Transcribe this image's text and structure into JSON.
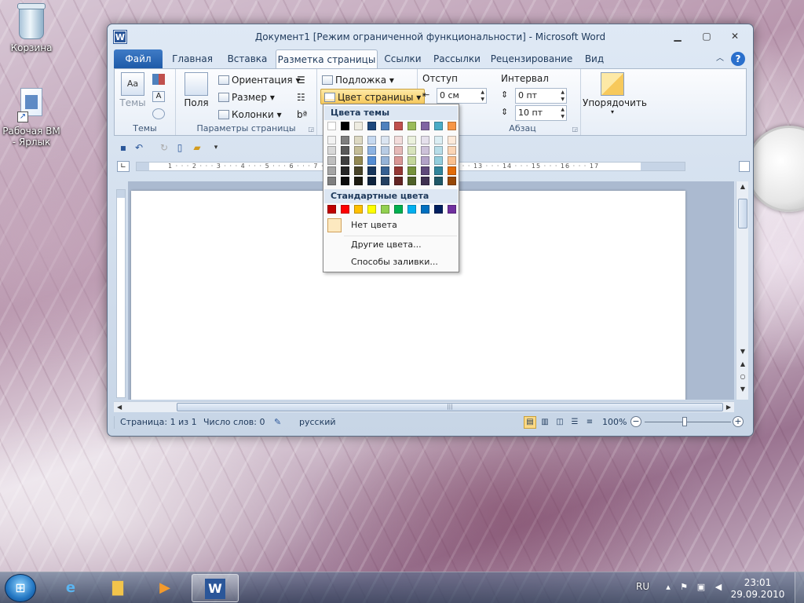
{
  "desktop": {
    "icons": [
      {
        "label": "Корзина"
      },
      {
        "label": "Рабочая ВМ - Ярлык"
      }
    ]
  },
  "window": {
    "title": "Документ1 [Режим ограниченной функциональности]  -  Microsoft Word",
    "app_icon": "W",
    "controls": {
      "minimize": "▁",
      "maximize": "▢",
      "close": "✕"
    }
  },
  "tabs": [
    "Файл",
    "Главная",
    "Вставка",
    "Разметка страницы",
    "Ссылки",
    "Рассылки",
    "Рецензирование",
    "Вид"
  ],
  "ribbon": {
    "themes_group": {
      "label": "Темы",
      "button": "Темы"
    },
    "page_setup": {
      "label": "Параметры страницы",
      "margins": "Поля",
      "orientation": "Ориентация",
      "size": "Размер",
      "columns": "Колонки"
    },
    "page_background": {
      "watermark": "Подложка",
      "page_color": "Цвет страницы"
    },
    "paragraph": {
      "label": "Абзац",
      "indent_label": "Отступ",
      "indent_left": "0 см",
      "spacing_label": "Интервал",
      "spacing_before": "0 пт",
      "spacing_after": "10 пт"
    },
    "arrange": {
      "label": "Упорядочить"
    }
  },
  "dropdown": {
    "theme_colors_title": "Цвета темы",
    "theme_top_row": [
      "#ffffff",
      "#000000",
      "#eeece1",
      "#1f497d",
      "#4f81bd",
      "#c0504d",
      "#9bbb59",
      "#8064a2",
      "#4bacc6",
      "#f79646"
    ],
    "theme_shades": [
      [
        "#f2f2f2",
        "#7f7f7f",
        "#ddd9c3",
        "#c6d9f0",
        "#dbe5f1",
        "#f2dcdb",
        "#ebf1dd",
        "#e5e0ec",
        "#dbeef3",
        "#fdeada"
      ],
      [
        "#d8d8d8",
        "#595959",
        "#c4bd97",
        "#8db3e2",
        "#b8cce4",
        "#e5b9b7",
        "#d7e3bc",
        "#ccc1d9",
        "#b7dde8",
        "#fbd5b5"
      ],
      [
        "#bfbfbf",
        "#3f3f3f",
        "#938953",
        "#548dd4",
        "#95b3d7",
        "#d99694",
        "#c3d69b",
        "#b2a2c7",
        "#92cddc",
        "#fac08f"
      ],
      [
        "#a5a5a5",
        "#262626",
        "#494429",
        "#17365d",
        "#366092",
        "#953734",
        "#76923c",
        "#5f497a",
        "#31859b",
        "#e36c09"
      ],
      [
        "#7f7f7f",
        "#0c0c0c",
        "#1d1b10",
        "#0f243e",
        "#244061",
        "#632423",
        "#4f6128",
        "#3f3151",
        "#205867",
        "#974806"
      ]
    ],
    "standard_colors_title": "Стандартные цвета",
    "standard_colors": [
      "#c00000",
      "#ff0000",
      "#ffc000",
      "#ffff00",
      "#92d050",
      "#00b050",
      "#00b0f0",
      "#0070c0",
      "#002060",
      "#7030a0"
    ],
    "no_color": "Нет цвета",
    "more_colors": "Другие цвета...",
    "fill_effects": "Способы заливки..."
  },
  "ruler": {
    "marks": "1 · · · 2 · · · 3 · · · 4 · · · 5 · · · 6 · · · 7 · · · 8 · · · 9 · · · 10 · · · 11 · · · 12 · · · 13 · · · 14 · · · 15 · · · 16 · · · 17"
  },
  "status": {
    "page": "Страница: 1 из 1",
    "words": "Число слов: 0",
    "language": "русский",
    "zoom": "100%"
  },
  "taskbar": {
    "language": "RU",
    "time": "23:01",
    "date": "29.09.2010"
  }
}
